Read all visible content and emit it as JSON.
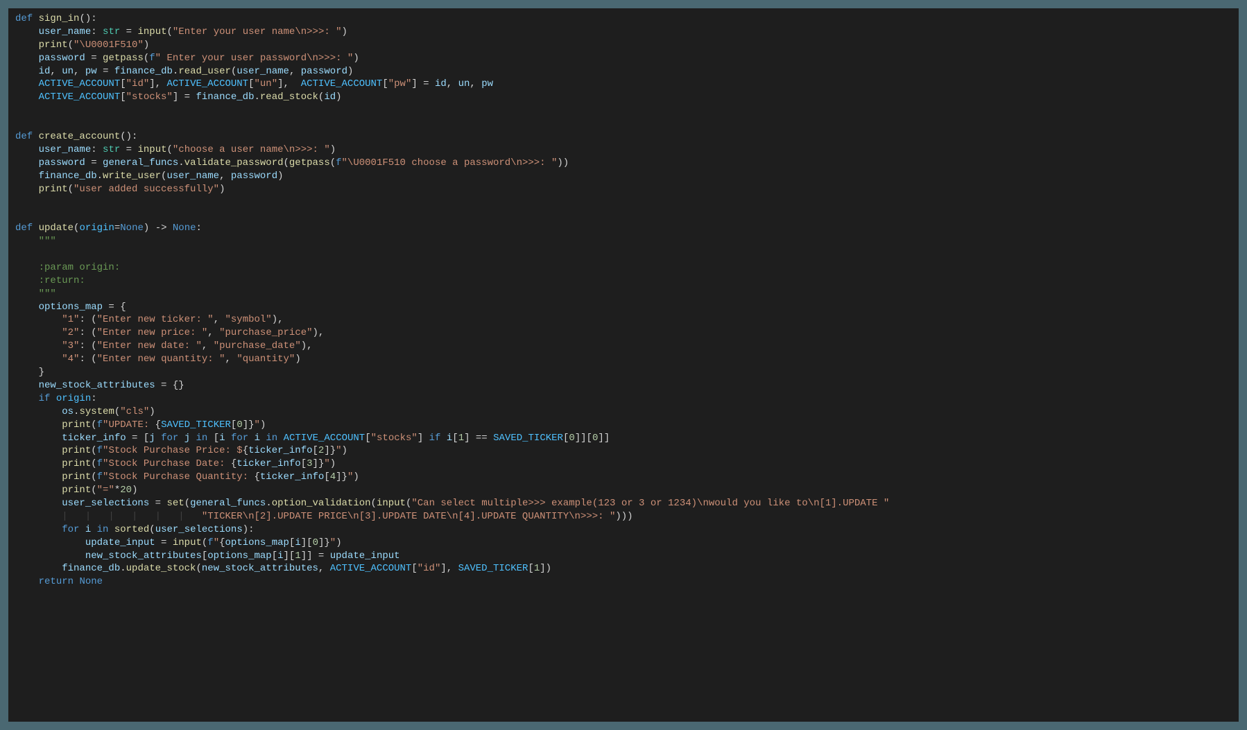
{
  "code": {
    "l01": {
      "kw_def": "def",
      "fn": "sign_in",
      "paren": "():"
    },
    "l02": {
      "var": "user_name",
      "colon": ": ",
      "type": "str",
      "eq": " = ",
      "fn": "input",
      "lp": "(",
      "str": "\"Enter your user name\\n>>>: \"",
      "rp": ")"
    },
    "l03": {
      "fn": "print",
      "lp": "(",
      "str": "\"\\U0001F510\"",
      "rp": ")"
    },
    "l04": {
      "var": "password",
      "eq": " = ",
      "fn": "getpass",
      "lp": "(",
      "fpre": "f",
      "str": "\" Enter your user password\\n>>>: \"",
      "rp": ")"
    },
    "l05": {
      "v1": "id",
      "c1": ", ",
      "v2": "un",
      "c2": ", ",
      "v3": "pw",
      "eq": " = ",
      "obj": "finance_db",
      "dot": ".",
      "fn": "read_user",
      "lp": "(",
      "a1": "user_name",
      "c3": ", ",
      "a2": "password",
      "rp": ")"
    },
    "l06": {
      "g": "ACTIVE_ACCOUNT",
      "lb1": "[",
      "k1": "\"id\"",
      "rb1": "], ",
      "g2": "ACTIVE_ACCOUNT",
      "lb2": "[",
      "k2": "\"un\"",
      "rb2": "],  ",
      "g3": "ACTIVE_ACCOUNT",
      "lb3": "[",
      "k3": "\"pw\"",
      "rb3": "] = ",
      "v1": "id",
      "c1": ", ",
      "v2": "un",
      "c2": ", ",
      "v3": "pw"
    },
    "l07": {
      "g": "ACTIVE_ACCOUNT",
      "lb": "[",
      "k": "\"stocks\"",
      "rb": "] = ",
      "obj": "finance_db",
      "dot": ".",
      "fn": "read_stock",
      "lp": "(",
      "a": "id",
      "rp": ")"
    },
    "l08": {
      "kw_def": "def",
      "fn": "create_account",
      "paren": "():"
    },
    "l09": {
      "var": "user_name",
      "colon": ": ",
      "type": "str",
      "eq": " = ",
      "fn": "input",
      "lp": "(",
      "str": "\"choose a user name\\n>>>: \"",
      "rp": ")"
    },
    "l10": {
      "var": "password",
      "eq": " = ",
      "obj": "general_funcs",
      "dot": ".",
      "fn": "validate_password",
      "lp": "(",
      "fn2": "getpass",
      "lp2": "(",
      "fpre": "f",
      "str": "\"\\U0001F510 choose a password\\n>>>: \"",
      "rp2": ")",
      "rp": ")"
    },
    "l11": {
      "obj": "finance_db",
      "dot": ".",
      "fn": "write_user",
      "lp": "(",
      "a1": "user_name",
      "c": ", ",
      "a2": "password",
      "rp": ")"
    },
    "l12": {
      "fn": "print",
      "lp": "(",
      "str": "\"user added successfully\"",
      "rp": ")"
    },
    "l13": {
      "kw_def": "def",
      "fn": "update",
      "lp": "(",
      "p": "origin",
      "eq": "=",
      "none": "None",
      "rp": ") -> ",
      "none2": "None",
      "colon": ":"
    },
    "l14": {
      "doc": "\"\"\""
    },
    "l15": {
      "doc": ":param origin:"
    },
    "l16": {
      "doc": ":return:"
    },
    "l17": {
      "doc": "\"\"\""
    },
    "l18": {
      "var": "options_map",
      "eq": " = {"
    },
    "l19": {
      "k": "\"1\"",
      "c": ": (",
      "s1": "\"Enter new ticker: \"",
      "cm": ", ",
      "s2": "\"symbol\"",
      "end": "),"
    },
    "l20": {
      "k": "\"2\"",
      "c": ": (",
      "s1": "\"Enter new price: \"",
      "cm": ", ",
      "s2": "\"purchase_price\"",
      "end": "),"
    },
    "l21": {
      "k": "\"3\"",
      "c": ": (",
      "s1": "\"Enter new date: \"",
      "cm": ", ",
      "s2": "\"purchase_date\"",
      "end": "),"
    },
    "l22": {
      "k": "\"4\"",
      "c": ": (",
      "s1": "\"Enter new quantity: \"",
      "cm": ", ",
      "s2": "\"quantity\"",
      "end": ")"
    },
    "l23": {
      "brace": "}"
    },
    "l24": {
      "var": "new_stock_attributes",
      "eq": " = {}"
    },
    "l25": {
      "kw": "if",
      "sp": " ",
      "v": "origin",
      "colon": ":"
    },
    "l26": {
      "obj": "os",
      "dot": ".",
      "fn": "system",
      "lp": "(",
      "str": "\"cls\"",
      "rp": ")"
    },
    "l27": {
      "fn": "print",
      "lp": "(",
      "fpre": "f",
      "s1": "\"UPDATE: ",
      "lb": "{",
      "g": "SAVED_TICKER",
      "idx": "[",
      "n": "0",
      "idx2": "]",
      "rb": "}",
      "s2": "\"",
      "rp": ")"
    },
    "l28": {
      "var": "ticker_info",
      "eq": " = [",
      "j": "j",
      "sp1": " ",
      "kw_for1": "for",
      "sp2": " ",
      "j2": "j",
      "sp3": " ",
      "kw_in1": "in",
      "sp4": " [",
      "i": "i",
      "sp5": " ",
      "kw_for2": "for",
      "sp6": " ",
      "i2": "i",
      "sp7": " ",
      "kw_in2": "in",
      "sp8": " ",
      "g": "ACTIVE_ACCOUNT",
      "lb": "[",
      "k": "\"stocks\"",
      "rb": "] ",
      "kw_if": "if",
      "sp9": " ",
      "i3": "i",
      "idx1": "[",
      "n1": "1",
      "idx1b": "] == ",
      "g2": "SAVED_TICKER",
      "idx2": "[",
      "n2": "0",
      "idx2b": "]][",
      "n3": "0",
      "end": "]]"
    },
    "l29": {
      "fn": "print",
      "lp": "(",
      "fpre": "f",
      "s1": "\"Stock Purchase Price: $",
      "lb": "{",
      "v": "ticker_info",
      "idx": "[",
      "n": "2",
      "idx2": "]",
      "rb": "}",
      "s2": "\"",
      "rp": ")"
    },
    "l30": {
      "fn": "print",
      "lp": "(",
      "fpre": "f",
      "s1": "\"Stock Purchase Date: ",
      "lb": "{",
      "v": "ticker_info",
      "idx": "[",
      "n": "3",
      "idx2": "]",
      "rb": "}",
      "s2": "\"",
      "rp": ")"
    },
    "l31": {
      "fn": "print",
      "lp": "(",
      "fpre": "f",
      "s1": "\"Stock Purchase Quantity: ",
      "lb": "{",
      "v": "ticker_info",
      "idx": "[",
      "n": "4",
      "idx2": "]",
      "rb": "}",
      "s2": "\"",
      "rp": ")"
    },
    "l32": {
      "fn": "print",
      "lp": "(",
      "str": "\"=\"",
      "op": "*",
      "n": "20",
      "rp": ")"
    },
    "l33": {
      "var": "user_selections",
      "eq": " = ",
      "fn_set": "set",
      "lp": "(",
      "obj": "general_funcs",
      "dot": ".",
      "fn": "option_validation",
      "lp2": "(",
      "fn_in": "input",
      "lp3": "(",
      "str": "\"Can select multiple>>> example(123 or 3 or 1234)\\nwould you like to\\n[1].UPDATE \""
    },
    "l34": {
      "pipes": "        ",
      "str": "\"TICKER\\n[2].UPDATE PRICE\\n[3].UPDATE DATE\\n[4].UPDATE QUANTITY\\n>>>: \"",
      "rp": ")))"
    },
    "l35": {
      "kw_for": "for",
      "sp1": " ",
      "i": "i",
      "sp2": " ",
      "kw_in": "in",
      "sp3": " ",
      "fn": "sorted",
      "lp": "(",
      "v": "user_selections",
      "rp": "):"
    },
    "l36": {
      "var": "update_input",
      "eq": " = ",
      "fn": "input",
      "lp": "(",
      "fpre": "f",
      "s1": "\"",
      "lb": "{",
      "v": "options_map",
      "idx1": "[",
      "i": "i",
      "idx1b": "][",
      "n": "0",
      "idx2": "]",
      "rb": "}",
      "s2": "\"",
      "rp": ")"
    },
    "l37": {
      "v1": "new_stock_attributes",
      "idx1": "[",
      "v2": "options_map",
      "idx2": "[",
      "i": "i",
      "idx2b": "][",
      "n": "1",
      "idx3": "]] = ",
      "v3": "update_input"
    },
    "l38": {
      "obj": "finance_db",
      "dot": ".",
      "fn": "update_stock",
      "lp": "(",
      "a1": "new_stock_attributes",
      "c1": ", ",
      "g1": "ACTIVE_ACCOUNT",
      "lb1": "[",
      "k1": "\"id\"",
      "rb1": "], ",
      "g2": "SAVED_TICKER",
      "lb2": "[",
      "n": "1",
      "rb2": "])"
    },
    "l39": {
      "kw": "return",
      "sp": " ",
      "none": "None"
    }
  }
}
